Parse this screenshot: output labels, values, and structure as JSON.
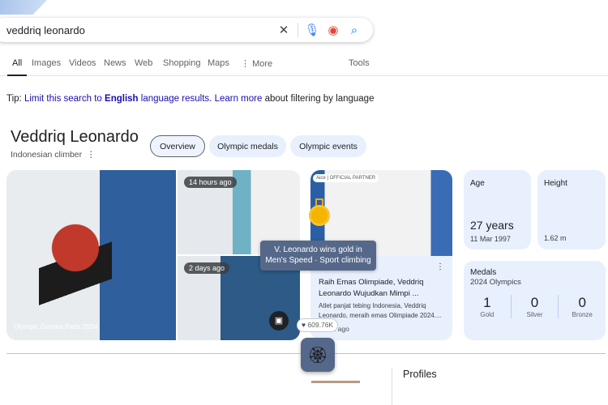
{
  "search": {
    "query": "veddriq leonardo",
    "icons": [
      "close-icon",
      "mic-icon",
      "lens-icon",
      "search-icon"
    ]
  },
  "tabs": [
    "All",
    "Images",
    "Videos",
    "News",
    "Web",
    "Shopping",
    "Maps",
    "More"
  ],
  "tools": "Tools",
  "tip": {
    "prefix": "Tip: ",
    "link1": "Limit this search to ",
    "bold": "English",
    "link1b": " language results.",
    "link2": "Learn more",
    "suffix": " about filtering by language"
  },
  "entity": {
    "name": "Veddriq Leonardo",
    "subtitle": "Indonesian climber",
    "chips": [
      "Overview",
      "Olympic medals",
      "Olympic events"
    ]
  },
  "images": {
    "main_caption": "Olympic Games Paris 2024",
    "badge1": "14 hours ago",
    "badge2": "2 days ago"
  },
  "news": {
    "title": "Raih Emas Olimpiade, Veddriq Leonardo Wujudkan Mimpi ...",
    "snippet": "Atlet panjat tebing Indonesia, Veddriq Leonardo, meraih emas Olimpiade 2024....",
    "time": "hours ago",
    "logo": "Aice | OFFICIAL PARTNER"
  },
  "facts": {
    "age_label": "Age",
    "age": "27 years",
    "dob": "11 Mar 1997",
    "height_label": "Height",
    "height": "1.62 m",
    "medals_label": "Medals",
    "medals_sub": "2024 Olympics",
    "medals": [
      {
        "count": "1",
        "type": "Gold"
      },
      {
        "count": "0",
        "type": "Silver"
      },
      {
        "count": "0",
        "type": "Bronze"
      }
    ]
  },
  "tooltip": {
    "line1": "V. Leonardo wins gold in",
    "line2": "Men's Speed · Sport climbing"
  },
  "likes": "609.76K",
  "profiles": "Profiles",
  "colors": {
    "accent": "#1a73e8",
    "card": "#e8f0fe",
    "tooltip": "#55688a"
  }
}
